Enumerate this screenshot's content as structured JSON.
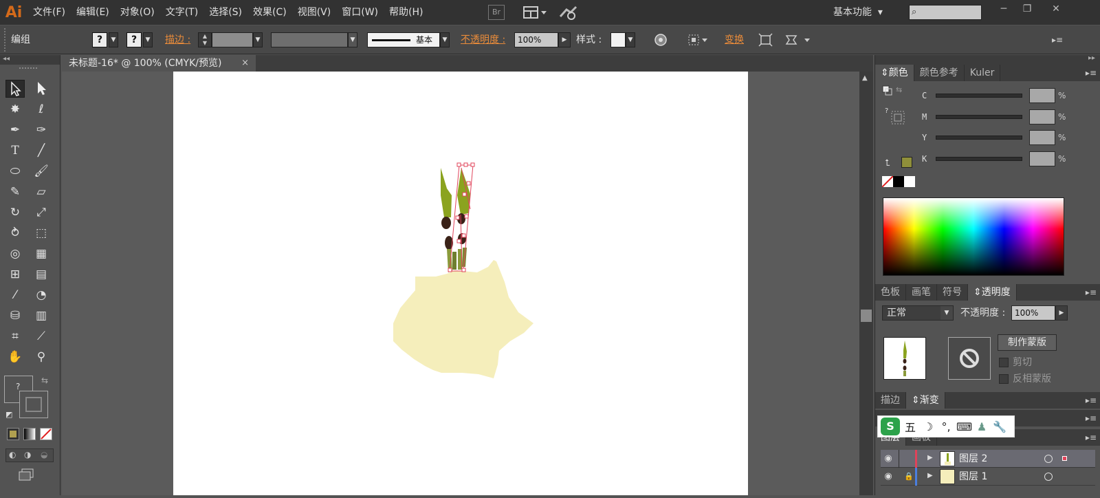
{
  "app": {
    "logo": "Ai",
    "bridge": "Br"
  },
  "menu": [
    "文件(F)",
    "编辑(E)",
    "对象(O)",
    "文字(T)",
    "选择(S)",
    "效果(C)",
    "视图(V)",
    "窗口(W)",
    "帮助(H)"
  ],
  "workspace": {
    "label": "基本功能",
    "arrow": "▾"
  },
  "search": {
    "value": ""
  },
  "window_buttons": {
    "minimize": "─",
    "restore": "❐",
    "close": "✕"
  },
  "control_bar": {
    "selection_type": "编组",
    "fill_swatch": "?",
    "stroke_swatch": "?",
    "stroke_label": "描边 :",
    "brush_label": "基本",
    "opacity_label": "不透明度 :",
    "opacity_value": "100%",
    "style_label": "样式 :",
    "transform_label": "变换"
  },
  "document_tab": {
    "title": "未标题-16* @ 100% (CMYK/预览)",
    "close": "×"
  },
  "color_panel": {
    "tabs": [
      "颜色",
      "颜色参考",
      "Kuler"
    ],
    "active_tab": "颜色",
    "channels": [
      {
        "label": "C",
        "value": ""
      },
      {
        "label": "M",
        "value": ""
      },
      {
        "label": "Y",
        "value": ""
      },
      {
        "label": "K",
        "value": ""
      }
    ],
    "unit": "%",
    "olive_color": "#8f8f3a"
  },
  "transparency_panel": {
    "tabs": [
      "色板",
      "画笔",
      "符号",
      "透明度"
    ],
    "active_tab": "透明度",
    "blend_mode": "正常",
    "opacity_label": "不透明度 :",
    "opacity_value": "100%",
    "make_mask": "制作蒙版",
    "clip": "剪切",
    "invert_mask": "反相蒙版"
  },
  "stroke_gradient_panel": {
    "tabs": [
      "描边",
      "渐变"
    ],
    "active_tab": "渐变"
  },
  "layers_panel": {
    "tabs": [
      "图层",
      "画板"
    ],
    "layers": [
      {
        "name": "图层 2",
        "selected": true
      },
      {
        "name": "图层 1",
        "selected": false
      }
    ]
  },
  "ime_bar": {
    "logo": "S",
    "mode": "五",
    "items": [
      "☽",
      "°,",
      "⌨",
      "♟",
      "🔧"
    ]
  },
  "artwork": {
    "hill_color": "#f5eebb",
    "leaf_color": "#8ba31f",
    "seed_color": "#3a2218",
    "stem_color": "#8a9a3a",
    "selection_color": "#e0435a"
  }
}
